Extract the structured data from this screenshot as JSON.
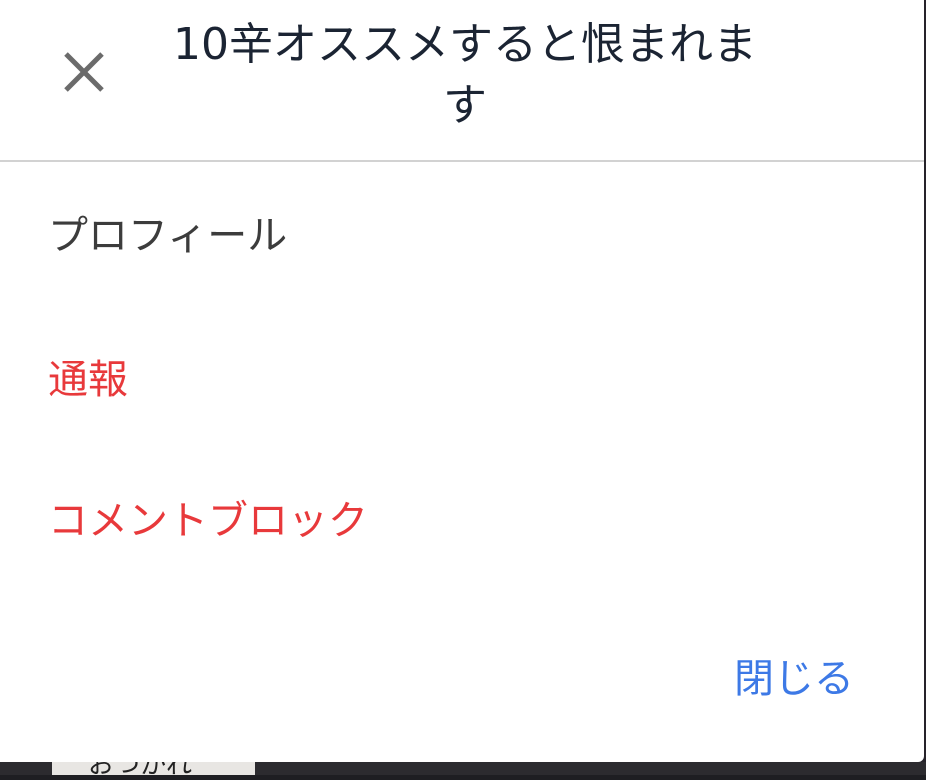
{
  "dialog": {
    "title": "10辛オススメすると恨まれます",
    "close_icon": "close-icon",
    "menu": [
      {
        "label": "プロフィール",
        "color": "#3c3c3c"
      },
      {
        "label": "通報",
        "color": "#e8393b"
      },
      {
        "label": "コメントブロック",
        "color": "#e8393b"
      }
    ],
    "close_button_label": "閉じる",
    "close_button_color": "#3d79e6"
  },
  "background": {
    "peek_text": "おつかれ"
  }
}
